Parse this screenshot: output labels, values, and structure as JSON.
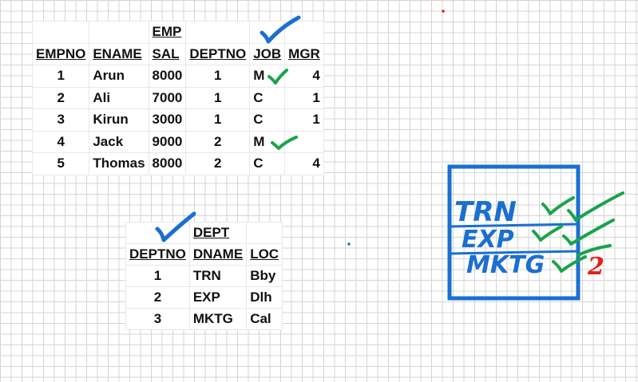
{
  "emp": {
    "title": "EMP",
    "headers": [
      "EMPNO",
      "ENAME",
      "SAL",
      "DEPTNO",
      "JOB",
      "MGR"
    ],
    "rows": [
      [
        "1",
        "Arun",
        "8000",
        "1",
        "M",
        "4"
      ],
      [
        "2",
        "Ali",
        "7000",
        "1",
        "C",
        "1"
      ],
      [
        "3",
        "Kirun",
        "3000",
        "1",
        "C",
        "1"
      ],
      [
        "4",
        "Jack",
        "9000",
        "2",
        "M",
        ""
      ],
      [
        "5",
        "Thomas",
        "8000",
        "2",
        "C",
        "4"
      ]
    ]
  },
  "dept": {
    "title": "DEPT",
    "headers": [
      "DEPTNO",
      "DNAME",
      "LOC"
    ],
    "rows": [
      [
        "1",
        "TRN",
        "Bby"
      ],
      [
        "2",
        "EXP",
        "Dlh"
      ],
      [
        "3",
        "MKTG",
        "Cal"
      ]
    ]
  },
  "annotations": {
    "box_items": [
      "TRN",
      "EXP",
      "MKTG"
    ],
    "mark": "2",
    "colors": {
      "blue_ink": "#1a6fd1",
      "green_ink": "#1aa34a",
      "red_ink": "#e0201a",
      "grid": "#d4d4d4"
    }
  }
}
